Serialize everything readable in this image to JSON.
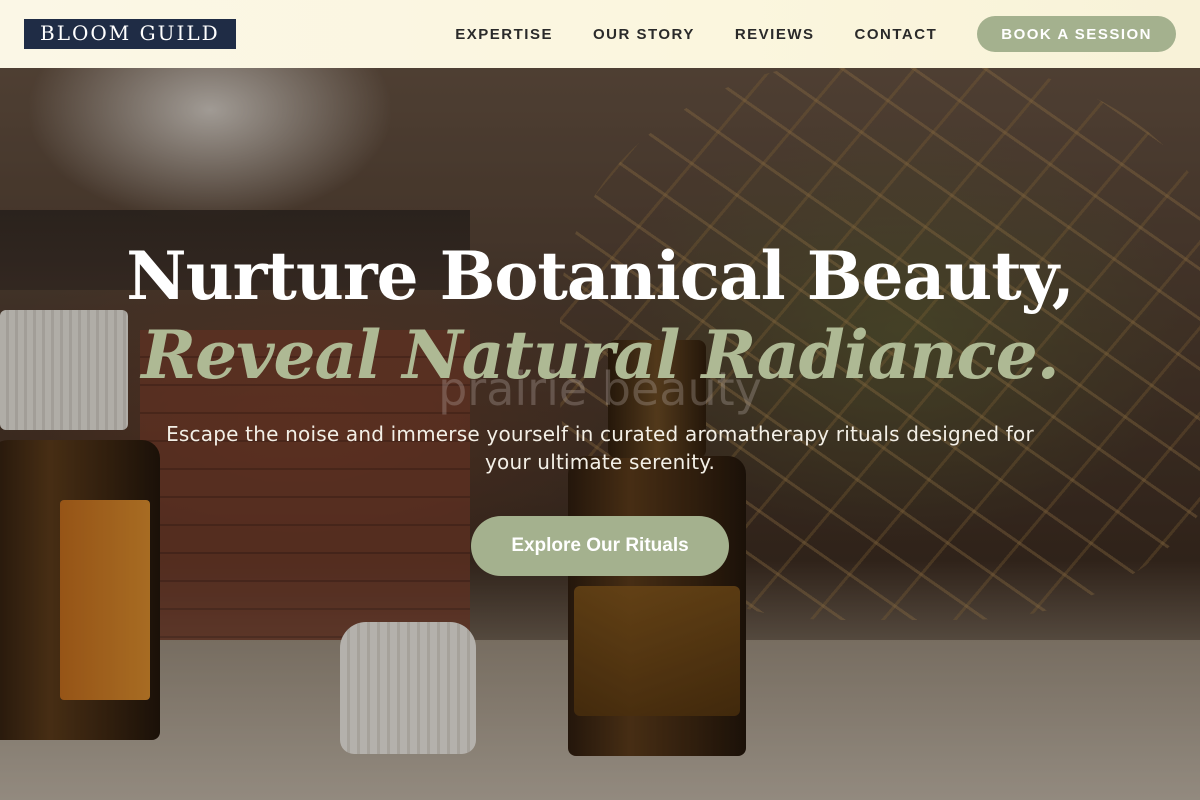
{
  "header": {
    "logo": "BLOOM GUILD",
    "nav": [
      {
        "label": "EXPERTISE"
      },
      {
        "label": "OUR STORY"
      },
      {
        "label": "REVIEWS"
      },
      {
        "label": "CONTACT"
      }
    ],
    "cta_label": "BOOK A SESSION"
  },
  "hero": {
    "headline_line1": "Nurture Botanical Beauty,",
    "headline_line2": "Reveal Natural Radiance.",
    "watermark": "prairie beauty",
    "subtitle": "Escape the noise and immerse yourself in curated aromatherapy rituals designed for your ultimate serenity.",
    "button_label": "Explore Our Rituals"
  },
  "colors": {
    "accent_sage": "#a4b18e",
    "logo_navy": "#1f2c45",
    "header_bg": "#fbf7e6",
    "headline_italic": "#aeb994"
  }
}
